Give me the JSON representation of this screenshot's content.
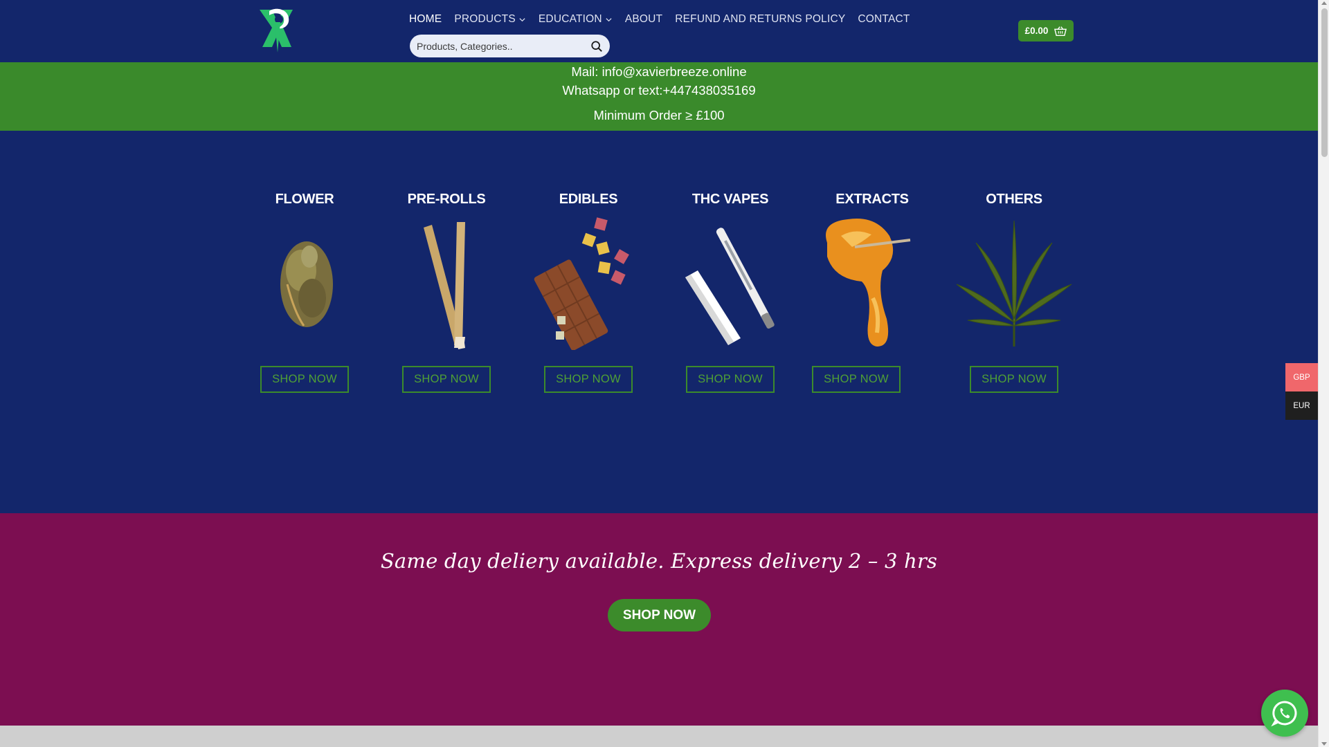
{
  "header": {
    "logo_alt": "XB",
    "nav": [
      {
        "label": "HOME",
        "active": true,
        "dropdown": false
      },
      {
        "label": "PRODUCTS",
        "active": false,
        "dropdown": true
      },
      {
        "label": "EDUCATION",
        "active": false,
        "dropdown": true
      },
      {
        "label": "ABOUT",
        "active": false,
        "dropdown": false
      },
      {
        "label": "REFUND AND RETURNS POLICY",
        "active": false,
        "dropdown": false
      },
      {
        "label": "CONTACT",
        "active": false,
        "dropdown": false
      }
    ],
    "search": {
      "placeholder": "Products, Categories.."
    },
    "cart": {
      "total": "£0.00"
    }
  },
  "info": {
    "mail": "Mail: info@xavierbreeze.online",
    "whatsapp": "Whatsapp or text:+447438035169",
    "min_order": "Minimum Order ≥ £100"
  },
  "categories": [
    {
      "title": "FLOWER",
      "button": "SHOP NOW"
    },
    {
      "title": "PRE-ROLLS",
      "button": "SHOP NOW"
    },
    {
      "title": "EDIBLES",
      "button": "SHOP NOW"
    },
    {
      "title": "THC VAPES",
      "button": "SHOP NOW"
    },
    {
      "title": "EXTRACTS",
      "button": "SHOP NOW"
    },
    {
      "title": "OTHERS",
      "button": "SHOP NOW"
    }
  ],
  "delivery": {
    "text": "Same day deliery available. Express delivery 2 – 3 hrs",
    "button": "SHOP NOW"
  },
  "currency": {
    "options": [
      "GBP",
      "EUR"
    ],
    "selected": "GBP"
  },
  "colors": {
    "header_bg": "#13266b",
    "green": "#3c8b2b",
    "magenta": "#7c0e51",
    "gbp_bg": "#f0676b"
  }
}
